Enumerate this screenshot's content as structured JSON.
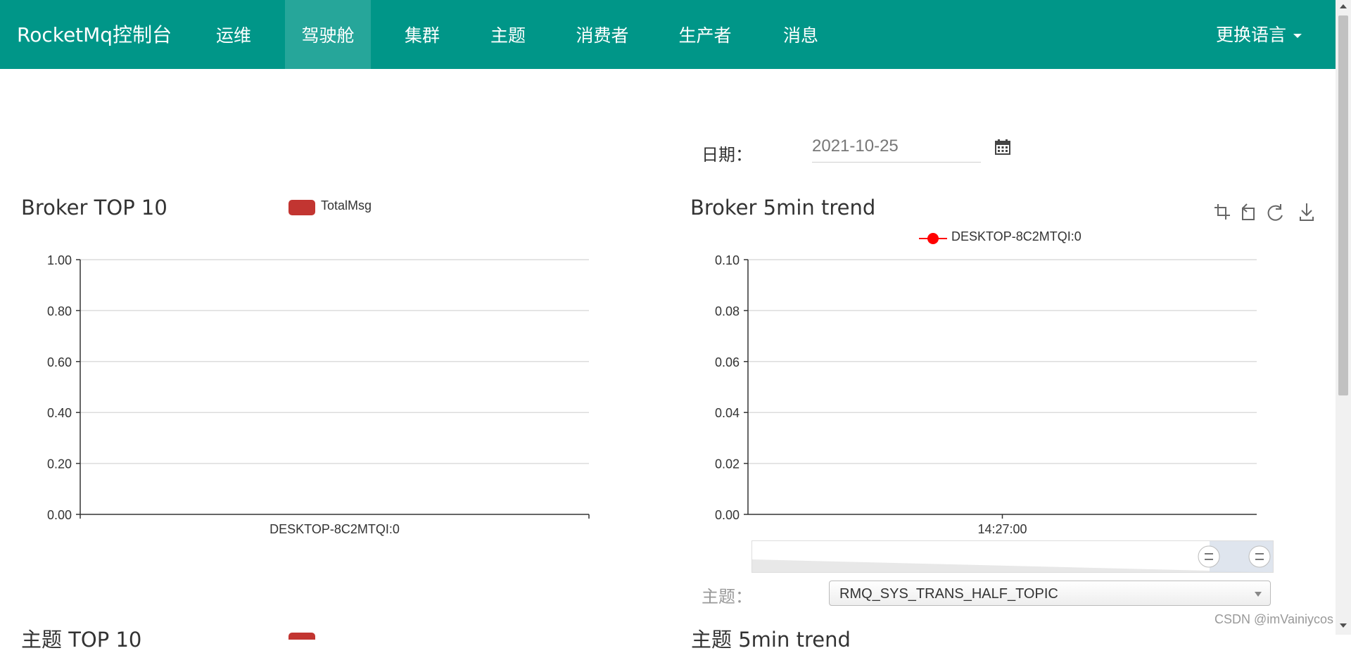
{
  "navbar": {
    "brand": "RocketMq控制台",
    "items": [
      {
        "label": "运维"
      },
      {
        "label": "驾驶舱"
      },
      {
        "label": "集群"
      },
      {
        "label": "主题"
      },
      {
        "label": "消费者"
      },
      {
        "label": "生产者"
      },
      {
        "label": "消息"
      }
    ],
    "active": "驾驶舱",
    "language": "更换语言"
  },
  "date": {
    "label": "日期：",
    "value": "2021-10-25"
  },
  "broker_top": {
    "title": "Broker TOP 10",
    "legend": "TotalMsg"
  },
  "broker_trend": {
    "title": "Broker 5min trend",
    "legend": "DESKTOP-8C2MTQI:0"
  },
  "topic": {
    "label": "主题：",
    "selected": "RMQ_SYS_TRANS_HALF_TOPIC"
  },
  "bottom": {
    "left_title": "主题 TOP 10",
    "right_title": "主题 5min trend"
  },
  "watermark": "CSDN @imVainiycos",
  "colors": {
    "navbar": "#009688",
    "bar_series": "#c23531",
    "line_series": "#ff0000"
  },
  "chart_data": [
    {
      "type": "bar",
      "title": "Broker TOP 10",
      "categories": [
        "DESKTOP-8C2MTQI:0"
      ],
      "series": [
        {
          "name": "TotalMsg",
          "values": [
            0
          ]
        }
      ],
      "ylim": [
        0,
        1
      ],
      "yticks": [
        "0.00",
        "0.20",
        "0.40",
        "0.60",
        "0.80",
        "1.00"
      ],
      "grid": true,
      "legend": "top-center"
    },
    {
      "type": "line",
      "title": "Broker 5min trend",
      "x": [
        "14:27:00"
      ],
      "series": [
        {
          "name": "DESKTOP-8C2MTQI:0",
          "values": []
        }
      ],
      "ylim": [
        0,
        0.1
      ],
      "yticks": [
        "0.00",
        "0.02",
        "0.04",
        "0.06",
        "0.08",
        "0.10"
      ],
      "grid": true,
      "legend": "top-center"
    }
  ]
}
